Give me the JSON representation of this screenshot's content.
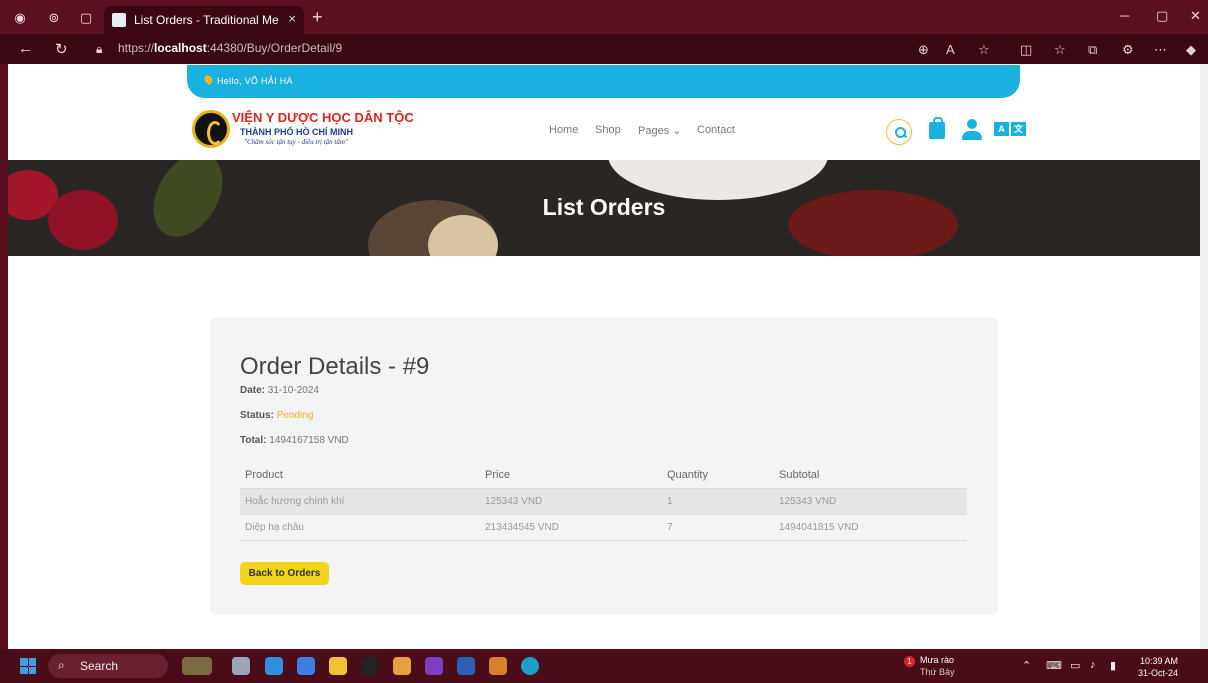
{
  "browser": {
    "tab_title": "List Orders - Traditional Medicine",
    "tab_close": "×",
    "new_tab": "+",
    "url_prefix": "https://",
    "url_host": "localhost",
    "url_rest": ":44380/Buy/OrderDetail/9"
  },
  "site": {
    "greeting": "Hello, VÕ HẢI HÀ",
    "logo_line1": "VIỆN Y DƯỢC HỌC DÂN TỘC",
    "logo_line2": "THÀNH PHỐ HỒ CHÍ MINH",
    "logo_line3": "\"Chăm sóc tận tụy - điều trị tận tâm\"",
    "nav": {
      "home": "Home",
      "shop": "Shop",
      "pages": "Pages ⌄",
      "contact": "Contact"
    },
    "translate_a": "A",
    "translate_b": "文"
  },
  "hero": {
    "title": "List Orders"
  },
  "order": {
    "heading": "Order Details - #9",
    "date_label": "Date:",
    "date_value": "31-10-2024",
    "status_label": "Status:",
    "status_value": "Pending",
    "total_label": "Total:",
    "total_value": "1494167158 VND",
    "columns": [
      "Product",
      "Price",
      "Quantity",
      "Subtotal"
    ],
    "rows": [
      [
        "Hoắc hương chính khí",
        "125343 VND",
        "1",
        "125343 VND"
      ],
      [
        "Diệp hạ châu",
        "213434545 VND",
        "7",
        "1494041815 VND"
      ]
    ],
    "back_button": "Back to Orders"
  },
  "taskbar": {
    "search": "Search",
    "weather_badge": "1",
    "weather_line1": "Mưa rào",
    "weather_line2": "Thứ Bảy",
    "time": "10:39 AM",
    "date": "31-Oct-24"
  },
  "colors": {
    "accent_blue": "#1ab0e0",
    "accent_yellow": "#f2d41b",
    "status_pending": "#f4b021"
  }
}
